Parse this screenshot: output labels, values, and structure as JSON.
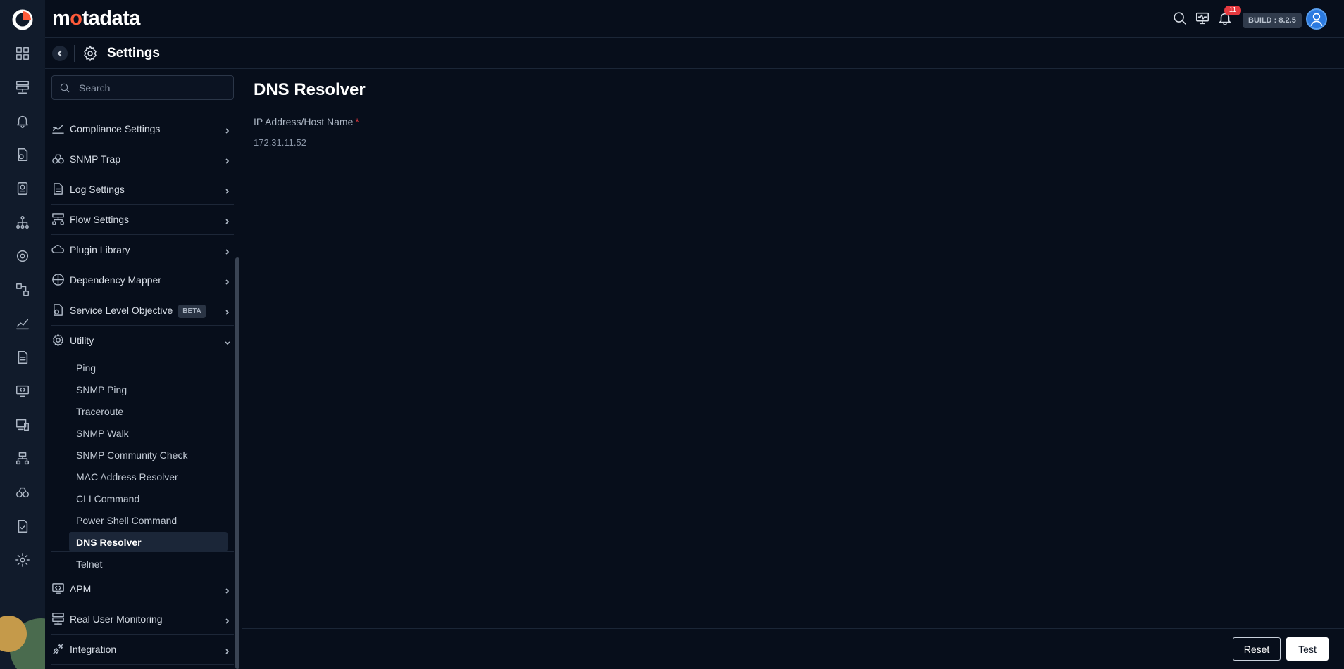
{
  "app": {
    "brand_prefix": "m",
    "brand_o": "o",
    "brand_suffix": "tadata",
    "build": "BUILD : 8.2.5",
    "notifications_count": "11"
  },
  "rail": {
    "icons": [
      "dashboard-icon",
      "inventory-icon",
      "alerts-icon",
      "policy-icon",
      "report-icon",
      "topology-icon",
      "monitor-icon",
      "workflow-icon",
      "metrics-icon",
      "log-icon",
      "apm-icon",
      "device-icon",
      "network-icon",
      "snmp-trap-icon",
      "compliance-icon",
      "settings-icon"
    ]
  },
  "header": {
    "title": "Settings"
  },
  "sidebar": {
    "search_placeholder": "Search",
    "items": [
      {
        "label": "Compliance Settings",
        "icon": "compliance-chart-icon"
      },
      {
        "label": "SNMP Trap",
        "icon": "binoculars-icon"
      },
      {
        "label": "Log Settings",
        "icon": "log-file-icon"
      },
      {
        "label": "Flow Settings",
        "icon": "flow-icon"
      },
      {
        "label": "Plugin Library",
        "icon": "cloud-plugin-icon"
      },
      {
        "label": "Dependency Mapper",
        "icon": "dependency-icon"
      },
      {
        "label": "Service Level Objective",
        "badge": "BETA",
        "icon": "slo-icon"
      },
      {
        "label": "Utility",
        "icon": "utility-gear-icon"
      },
      {
        "label": "APM",
        "icon": "apm-monitor-icon"
      },
      {
        "label": "Real User Monitoring",
        "icon": "rum-icon"
      },
      {
        "label": "Integration",
        "icon": "integration-icon"
      }
    ],
    "utility_children": [
      "Ping",
      "SNMP Ping",
      "Traceroute",
      "SNMP Walk",
      "SNMP Community Check",
      "MAC Address Resolver",
      "CLI Command",
      "Power Shell Command",
      "DNS Resolver",
      "Telnet"
    ],
    "active_child": "DNS Resolver"
  },
  "main": {
    "title": "DNS Resolver",
    "field_label": "IP Address/Host Name",
    "required_mark": "*",
    "field_value": "172.31.11.52"
  },
  "footer": {
    "reset_label": "Reset",
    "test_label": "Test"
  },
  "colors": {
    "background": "#070e1b",
    "rail": "#111b2b",
    "accent": "#ff5b3a",
    "badge": "#e5393f"
  }
}
